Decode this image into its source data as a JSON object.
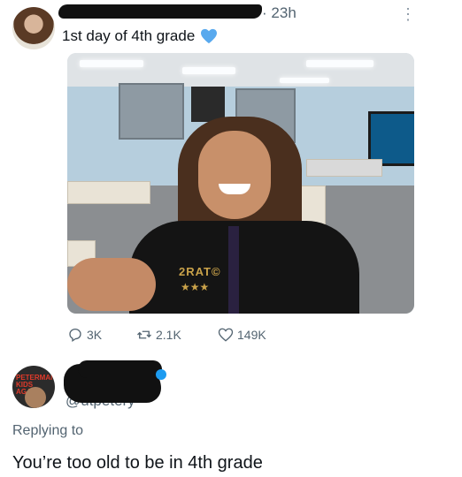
{
  "tweet": {
    "timestamp": "23h",
    "time_separator": "·",
    "text": "1st day of 4th grade",
    "more_icon": "more-dots-icon",
    "heart_emoji": "blue-heart-icon",
    "shirt_text": "2RAT©",
    "stats": {
      "replies": "3K",
      "retweets": "2.1K",
      "likes": "149K"
    }
  },
  "reply": {
    "avatar_text": "PETERMAN KIDS AGAI",
    "handle_partial": "@utpetery",
    "replying_label": "Replying to",
    "text": "You’re too old to be in 4th grade"
  },
  "colors": {
    "text_primary": "#0f1419",
    "text_secondary": "#536471",
    "accent_blue": "#1d9bf0"
  }
}
